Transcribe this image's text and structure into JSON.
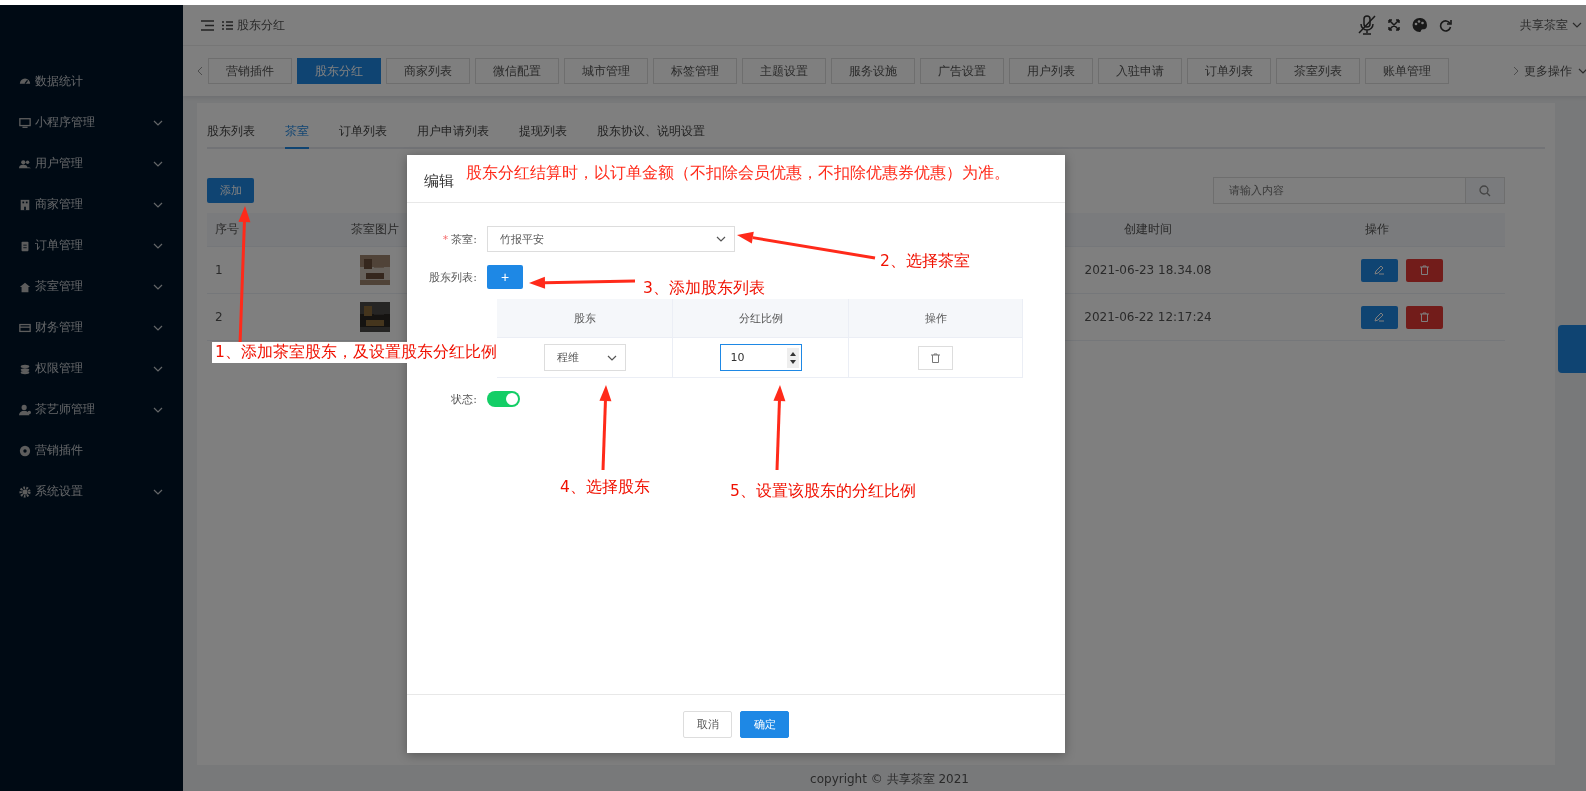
{
  "sidebar": {
    "items": [
      {
        "label": "数据统计",
        "expandable": false
      },
      {
        "label": "小程序管理",
        "expandable": true
      },
      {
        "label": "用户管理",
        "expandable": true
      },
      {
        "label": "商家管理",
        "expandable": true
      },
      {
        "label": "订单管理",
        "expandable": true
      },
      {
        "label": "茶室管理",
        "expandable": true
      },
      {
        "label": "财务管理",
        "expandable": true
      },
      {
        "label": "权限管理",
        "expandable": true
      },
      {
        "label": "茶艺师管理",
        "expandable": true
      },
      {
        "label": "营销插件",
        "expandable": false
      },
      {
        "label": "系统设置",
        "expandable": true
      }
    ]
  },
  "header": {
    "breadcrumb": "股东分红",
    "user": "共享茶室"
  },
  "page_tabs": {
    "items": [
      {
        "label": "营销插件",
        "selected": false
      },
      {
        "label": "股东分红",
        "selected": true
      },
      {
        "label": "商家列表",
        "selected": false
      },
      {
        "label": "微信配置",
        "selected": false
      },
      {
        "label": "城市管理",
        "selected": false
      },
      {
        "label": "标签管理",
        "selected": false
      },
      {
        "label": "主题设置",
        "selected": false
      },
      {
        "label": "服务设施",
        "selected": false
      },
      {
        "label": "广告设置",
        "selected": false
      },
      {
        "label": "用户列表",
        "selected": false
      },
      {
        "label": "入驻申请",
        "selected": false
      },
      {
        "label": "订单列表",
        "selected": false
      },
      {
        "label": "茶室列表",
        "selected": false
      },
      {
        "label": "账单管理",
        "selected": false
      }
    ],
    "more": "更多操作"
  },
  "sub_tabs": [
    {
      "label": "股东列表",
      "selected": false
    },
    {
      "label": "茶室",
      "selected": true
    },
    {
      "label": "订单列表",
      "selected": false
    },
    {
      "label": "用户申请列表",
      "selected": false
    },
    {
      "label": "提现列表",
      "selected": false
    },
    {
      "label": "股东协议、说明设置",
      "selected": false
    }
  ],
  "add_button": "添加",
  "search": {
    "placeholder": "请输入内容"
  },
  "table": {
    "columns": [
      "序号",
      "茶室图片",
      "创建时间",
      "操作"
    ],
    "rows": [
      {
        "index": "1",
        "created": "2021-06-23 18.34.08"
      },
      {
        "index": "2",
        "created": "2021-06-22 12:17:24"
      }
    ]
  },
  "footer": "copyright © 共享茶室 2021",
  "dialog": {
    "title": "编辑",
    "note": "股东分红结算时，以订单金额（不扣除会员优惠，不扣除优惠券优惠）为准。",
    "tea_room": {
      "required_mark": "*",
      "label": "茶室:",
      "value": "竹报平安"
    },
    "shareholders": {
      "label": "股东列表:",
      "add": "+",
      "columns": [
        "股东",
        "分红比例",
        "操作"
      ],
      "rows": [
        {
          "shareholder": "程维",
          "ratio": "10"
        }
      ]
    },
    "status": {
      "label": "状态:",
      "on": true
    },
    "buttons": [
      "取消",
      "确定"
    ]
  },
  "annotations": [
    {
      "text": "1、添加茶室股东，及设置股东分红比例"
    },
    {
      "text": "2、选择茶室"
    },
    {
      "text": "3、添加股东列表"
    },
    {
      "text": "4、选择股东"
    },
    {
      "text": "5、设置该股东的分红比例"
    }
  ]
}
